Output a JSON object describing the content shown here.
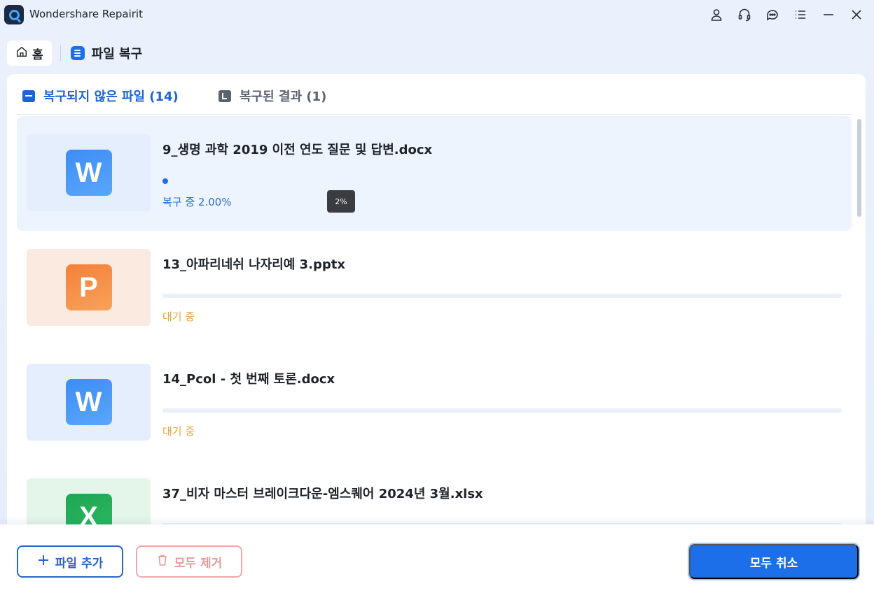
{
  "app": {
    "title": "Wondershare Repairit"
  },
  "window_icons": [
    "user-icon",
    "headset-icon",
    "chat-icon",
    "menu-list-icon",
    "minimize-icon",
    "close-icon"
  ],
  "breadcrumb": {
    "home_label": "홈",
    "current_label": "파일 복구"
  },
  "tabs": [
    {
      "label": "복구되지 않은 파일 (14)",
      "active": true
    },
    {
      "label": "복구된 결과 (1)",
      "active": false
    }
  ],
  "files": [
    {
      "name": "9_생명 과학 2019 이전 연도 질문 및 답변.docx",
      "type": "word",
      "badge": "W",
      "status": "복구 중 2.00%",
      "progress": 0.02,
      "tooltip": "2%"
    },
    {
      "name": "13_아파리네쉬 나자리예 3.pptx",
      "type": "ppt",
      "badge": "P",
      "status": "대기 중",
      "progress": 0
    },
    {
      "name": "14_Pcol - 첫 번째 토론.docx",
      "type": "word",
      "badge": "W",
      "status": "대기 중",
      "progress": 0
    },
    {
      "name": "37_비자 마스터 브레이크다운-엠스퀘어 2024년 3월.xlsx",
      "type": "excel",
      "badge": "X",
      "status": "",
      "progress": 0
    }
  ],
  "footer": {
    "add_label": "파일 추가",
    "remove_label": "모두 제거",
    "cancel_label": "모두 취소"
  },
  "colors": {
    "accent": "#1c6fe8",
    "waiting": "#e9a53e",
    "remove": "#e89a9a"
  }
}
